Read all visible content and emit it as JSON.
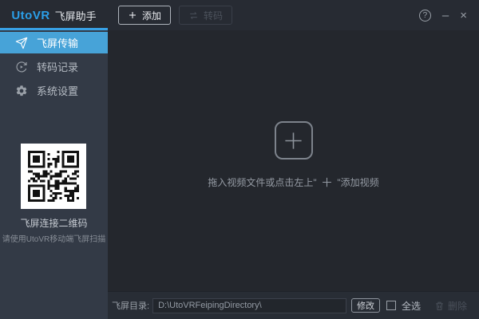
{
  "window": {
    "brand": "UtoVR",
    "app_name": "飞屏助手",
    "help_glyph": "?",
    "minimize_glyph": "–",
    "close_glyph": "×"
  },
  "toolbar": {
    "add_label": "添加",
    "transcode_label": "转码"
  },
  "sidebar": {
    "items": [
      {
        "label": "飞屏传输",
        "active": true
      },
      {
        "label": "转码记录",
        "active": false
      },
      {
        "label": "系统设置",
        "active": false
      }
    ],
    "qr_caption": "飞屏连接二维码",
    "qr_hint": "请使用UtoVR移动端飞屏扫描"
  },
  "main": {
    "hint_prefix": "拖入视频文件或点击左上\" ",
    "hint_plus": "＋",
    "hint_suffix": " \"添加视频"
  },
  "bottombar": {
    "dir_label": "飞屏目录:",
    "dir_value": "D:\\UtoVRFeipingDirectory\\",
    "modify_label": "修改",
    "select_all_label": "全选",
    "delete_label": "删除"
  },
  "colors": {
    "brand_blue": "#2b9fe8",
    "accent_underline": "#38a1e6",
    "active_item_blue": "#47a3d8",
    "topbar_bg": "#272b33",
    "sidebar_bg": "#333a46",
    "main_bg": "#24272d",
    "bottombar_bg": "#282d35"
  }
}
